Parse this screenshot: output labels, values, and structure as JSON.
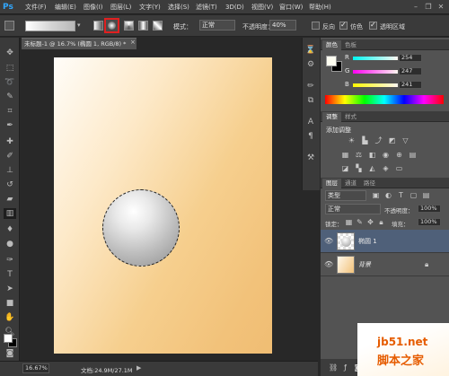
{
  "app": {
    "logo": "Ps"
  },
  "menu": [
    "文件(F)",
    "编辑(E)",
    "图像(I)",
    "图层(L)",
    "文字(Y)",
    "选择(S)",
    "滤镜(T)",
    "3D(D)",
    "视图(V)",
    "窗口(W)",
    "帮助(H)"
  ],
  "window_controls": {
    "minimize": "–",
    "restore": "❐",
    "close": "✕"
  },
  "options": {
    "mode_label": "模式：",
    "mode_value": "正常",
    "opacity_label": "不透明度：",
    "opacity_value": "40%",
    "reverse_label": "反向",
    "dither_label": "仿色",
    "transparency_label": "透明区域"
  },
  "document": {
    "tab_title": "未标题-1 @ 16.7% (椭圆 1, RGB/8) *",
    "zoom": "16.67%",
    "info": "文档:24.9M/27.1M"
  },
  "color_panel": {
    "tabs": [
      "颜色",
      "色板"
    ],
    "r_label": "R",
    "r_value": "254",
    "g_label": "G",
    "g_value": "247",
    "b_label": "B",
    "b_value": "241"
  },
  "adjust_panel": {
    "tabs": [
      "调整",
      "样式"
    ],
    "title": "添加调整"
  },
  "layers_panel": {
    "tabs": [
      "图层",
      "通道",
      "路径"
    ],
    "filter_kind": "类型",
    "blend_mode": "正常",
    "opacity_label": "不透明度：",
    "opacity_value": "100%",
    "lock_label": "锁定：",
    "fill_label": "填充：",
    "fill_value": "100%",
    "layers": [
      {
        "name": "椭圆 1"
      },
      {
        "name": "背景"
      }
    ]
  },
  "watermark": {
    "line1": "jb51.net",
    "line2": "脚本之家"
  },
  "colors": {
    "accent_red": "#e02020",
    "foreground": "#ffffff",
    "background": "#000000"
  }
}
